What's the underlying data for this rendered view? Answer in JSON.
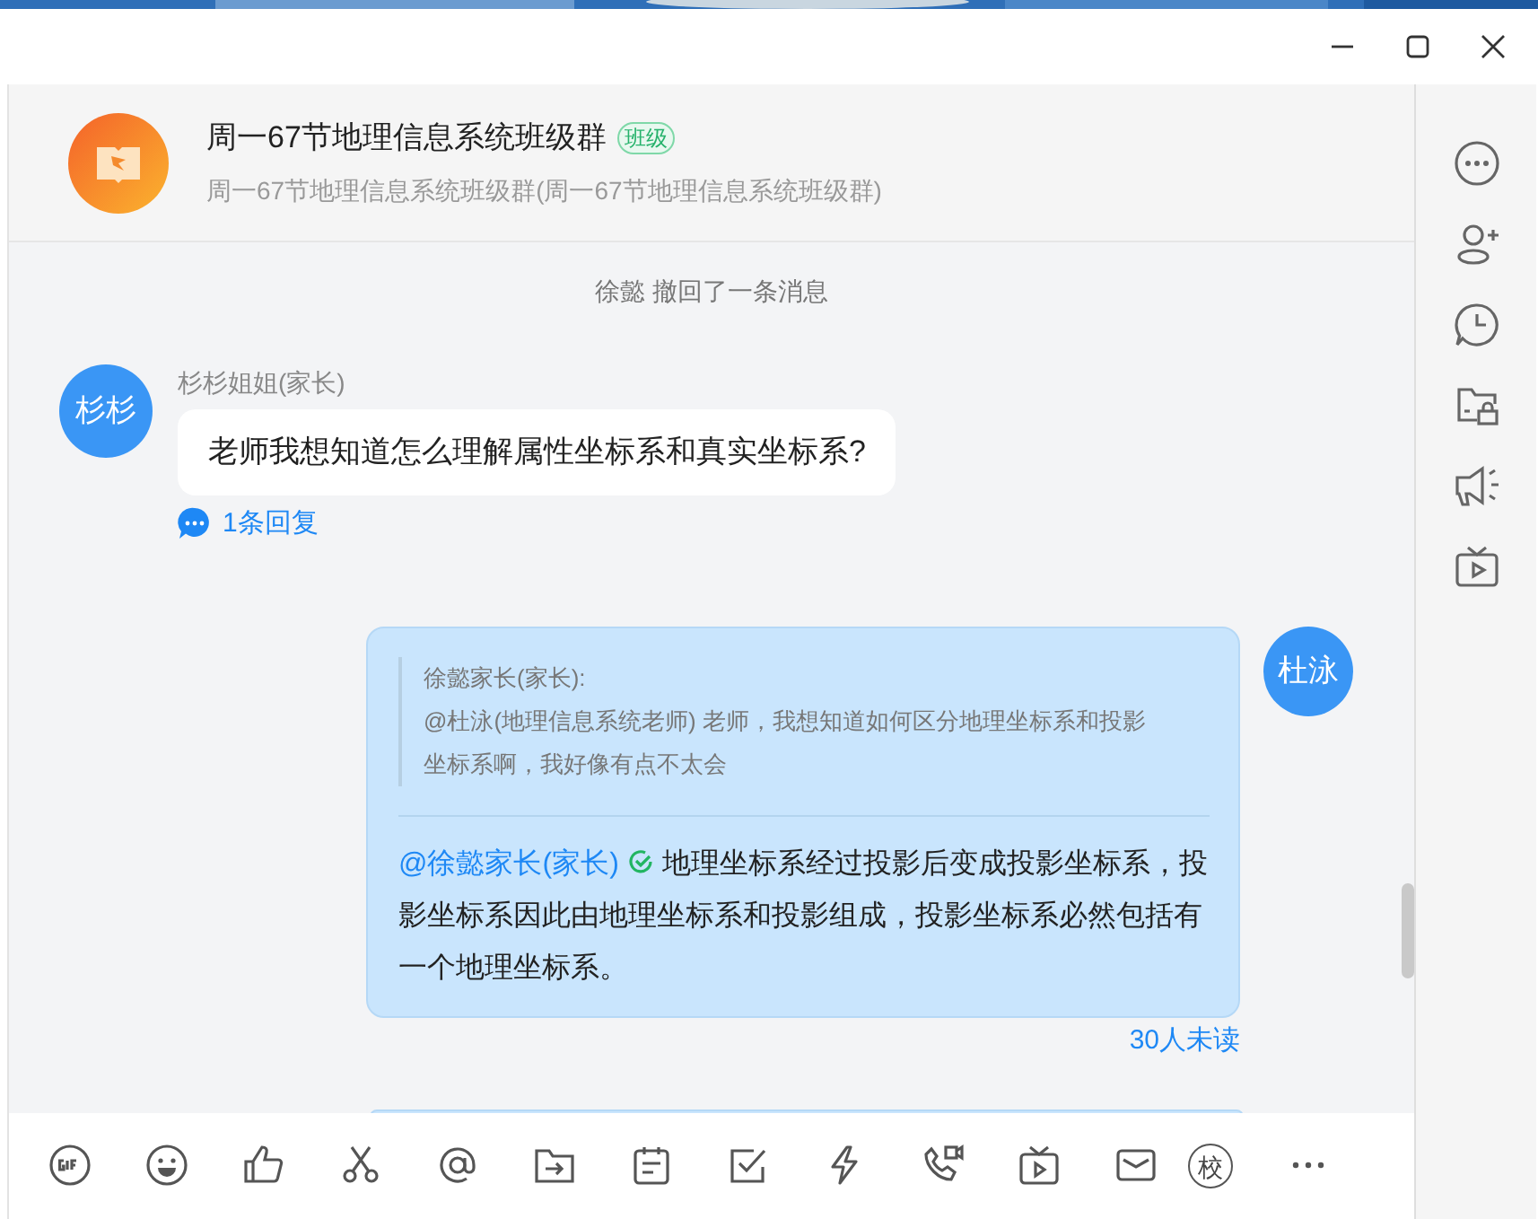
{
  "header": {
    "title": "周一67节地理信息系统班级群",
    "badge": "班级",
    "subtitle": "周一67节地理信息系统班级群(周一67节地理信息系统班级群)"
  },
  "messages": [
    {
      "kind": "notice",
      "text": "徐懿 撤回了一条消息"
    },
    {
      "kind": "incoming",
      "avatar_text": "杉杉",
      "sender": "杉杉姐姐(家长)",
      "text": "老师我想知道怎么理解属性坐标系和真实坐标系?",
      "replies": "1条回复"
    },
    {
      "kind": "outgoing",
      "avatar_text": "杜泳",
      "quote": {
        "author": "徐懿家长(家长):",
        "text": "@杜泳(地理信息系统老师) 老师，我想知道如何区分地理坐标系和投影坐标系啊，我好像有点不太会"
      },
      "mention": "@徐懿家长(家长)",
      "mention_verified": true,
      "text": "地理坐标系经过投影后变成投影坐标系，投影坐标系因此由地理坐标系和投影组成，投影坐标系必然包括有一个地理坐标系。",
      "read_status": "30人未读"
    }
  ],
  "toolbar": {
    "school_label": "校"
  }
}
